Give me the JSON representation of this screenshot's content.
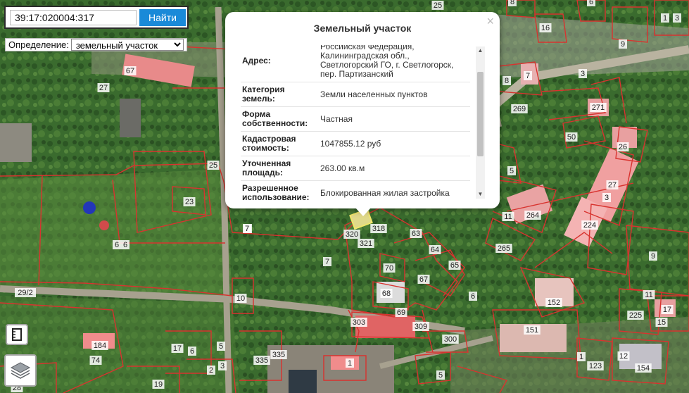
{
  "search": {
    "value": "39:17:020004:317",
    "button": "Найти"
  },
  "definition": {
    "label": "Определение:",
    "selected": "земельный участок"
  },
  "popup": {
    "title": "Земельный участок",
    "close": "×",
    "rows": [
      {
        "key": "Адрес:",
        "value": "Российская Федерация, Калининградская обл., Светлогорский ГО, г. Светлогорск, пер. Партизанский"
      },
      {
        "key": "Категория земель:",
        "value": "Земли населенных пунктов"
      },
      {
        "key": "Форма собственности:",
        "value": "Частная"
      },
      {
        "key": "Кадастровая стоимость:",
        "value": "1047855.12 руб"
      },
      {
        "key": "Уточненная площадь:",
        "value": "263.00 кв.м"
      },
      {
        "key": "Разрешенное использование:",
        "value": "Блокированная жилая застройка"
      }
    ]
  },
  "map": {
    "parcel_labels": [
      "25",
      "8",
      "6",
      "1",
      "3",
      "9",
      "16",
      "67",
      "27",
      "8",
      "7",
      "3",
      "271",
      "269",
      "50",
      "26",
      "27",
      "3",
      "224",
      "25",
      "23",
      "5",
      "11",
      "264",
      "318",
      "320",
      "321",
      "63",
      "64",
      "65",
      "70",
      "67",
      "7",
      "7",
      "6",
      "265",
      "6",
      "9",
      "68",
      "69",
      "303",
      "309",
      "300",
      "151",
      "152",
      "29/2",
      "10",
      "11",
      "225",
      "17",
      "15",
      "184",
      "74",
      "17",
      "6",
      "5",
      "335",
      "335",
      "3",
      "1",
      "5",
      "1",
      "123",
      "12",
      "154",
      "19",
      "28",
      "2",
      "7",
      "6"
    ]
  },
  "colors": {
    "parcel_stroke": "#d8332f",
    "parcel_label_bg": "#ffffff",
    "search_button": "#1a8ad8"
  },
  "icons": {
    "layers": "layers-icon",
    "ruler": "ruler-icon"
  }
}
